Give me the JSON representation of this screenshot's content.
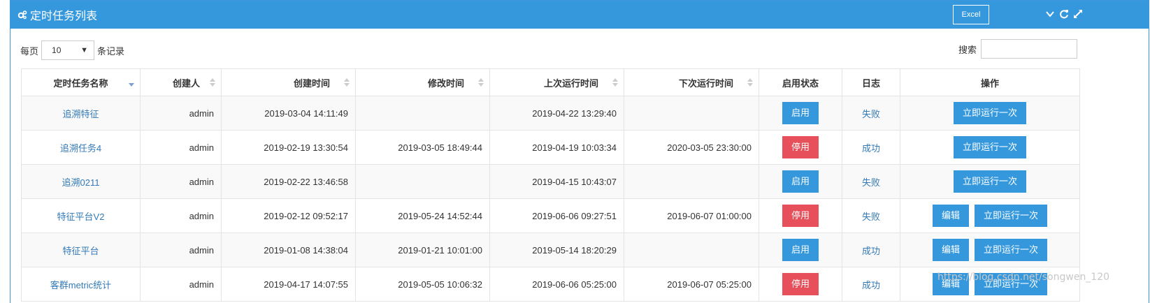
{
  "header": {
    "title": "定时任务列表",
    "excel_label": "Excel",
    "icons": [
      "cogs-icon",
      "chevron-down-icon",
      "refresh-icon",
      "fullscreen-icon"
    ]
  },
  "length_menu": {
    "prefix": "每页",
    "value": "10",
    "suffix": "条记录"
  },
  "search": {
    "label": "搜索",
    "value": ""
  },
  "table": {
    "columns": [
      "定时任务名称",
      "创建人",
      "创建时间",
      "修改时间",
      "上次运行时间",
      "下次运行时间",
      "启用状态",
      "日志",
      "操作"
    ],
    "rows": [
      {
        "name": "追溯特征",
        "creator": "admin",
        "created": "2019-03-04 14:11:49",
        "modified": "",
        "last_run": "2019-04-22 13:29:40",
        "next_run": "",
        "status": "启用",
        "status_color": "blue",
        "log": "失败",
        "actions": [
          "立即运行一次"
        ]
      },
      {
        "name": "追溯任务4",
        "creator": "admin",
        "created": "2019-02-19 13:30:54",
        "modified": "2019-03-05 18:49:44",
        "last_run": "2019-04-19 10:03:34",
        "next_run": "2020-03-05 23:30:00",
        "status": "停用",
        "status_color": "red",
        "log": "成功",
        "actions": [
          "立即运行一次"
        ]
      },
      {
        "name": "追溯0211",
        "creator": "admin",
        "created": "2019-02-22 13:46:58",
        "modified": "",
        "last_run": "2019-04-15 10:43:07",
        "next_run": "",
        "status": "启用",
        "status_color": "blue",
        "log": "失败",
        "actions": [
          "立即运行一次"
        ]
      },
      {
        "name": "特征平台V2",
        "creator": "admin",
        "created": "2019-02-12 09:52:17",
        "modified": "2019-05-24 14:52:44",
        "last_run": "2019-06-06 09:27:51",
        "next_run": "2019-06-07 01:00:00",
        "status": "停用",
        "status_color": "red",
        "log": "失败",
        "actions": [
          "编辑",
          "立即运行一次"
        ]
      },
      {
        "name": "特征平台",
        "creator": "admin",
        "created": "2019-01-08 14:38:04",
        "modified": "2019-01-21 10:01:00",
        "last_run": "2019-05-14 18:20:29",
        "next_run": "",
        "status": "启用",
        "status_color": "blue",
        "log": "成功",
        "actions": [
          "编辑",
          "立即运行一次"
        ]
      },
      {
        "name": "客群metric统计",
        "creator": "admin",
        "created": "2019-04-17 14:07:55",
        "modified": "2019-05-05 10:06:32",
        "last_run": "2019-06-06 05:25:00",
        "next_run": "2019-06-07 05:25:00",
        "status": "停用",
        "status_color": "red",
        "log": "成功",
        "actions": [
          "编辑",
          "立即运行一次"
        ]
      }
    ]
  },
  "watermark": "https://blog.csdn.net/songwen_120",
  "colors": {
    "primary": "#3598dc",
    "danger": "#e7505a",
    "link": "#337ab7"
  }
}
